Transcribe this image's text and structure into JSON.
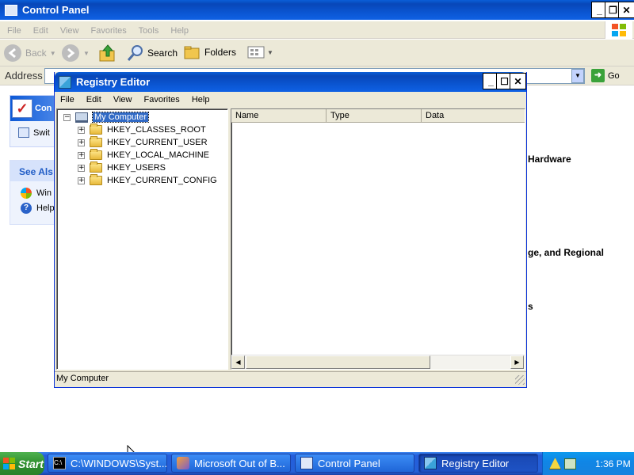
{
  "control_panel": {
    "title": "Control Panel",
    "menu": [
      "File",
      "Edit",
      "View",
      "Favorites",
      "Tools",
      "Help"
    ],
    "toolbar": {
      "back": "Back",
      "search": "Search",
      "folders": "Folders"
    },
    "address_label": "Address",
    "go_label": "Go",
    "sidebar": {
      "task_title": "Con",
      "switch_label": "Swit",
      "see_also_title": "See Als",
      "see_also_items": [
        "Win",
        "Help"
      ]
    },
    "peek_items": [
      "Hardware",
      "ge, and Regional",
      "s"
    ]
  },
  "regedit": {
    "title": "Registry Editor",
    "menu": [
      "File",
      "Edit",
      "View",
      "Favorites",
      "Help"
    ],
    "tree_root": "My Computer",
    "tree_items": [
      "HKEY_CLASSES_ROOT",
      "HKEY_CURRENT_USER",
      "HKEY_LOCAL_MACHINE",
      "HKEY_USERS",
      "HKEY_CURRENT_CONFIG"
    ],
    "columns": [
      "Name",
      "Type",
      "Data"
    ],
    "status": "My Computer"
  },
  "taskbar": {
    "start": "Start",
    "tasks": [
      "C:\\WINDOWS\\Syst...",
      "Microsoft Out of B...",
      "Control Panel",
      "Registry Editor"
    ],
    "clock": "1:36 PM"
  }
}
